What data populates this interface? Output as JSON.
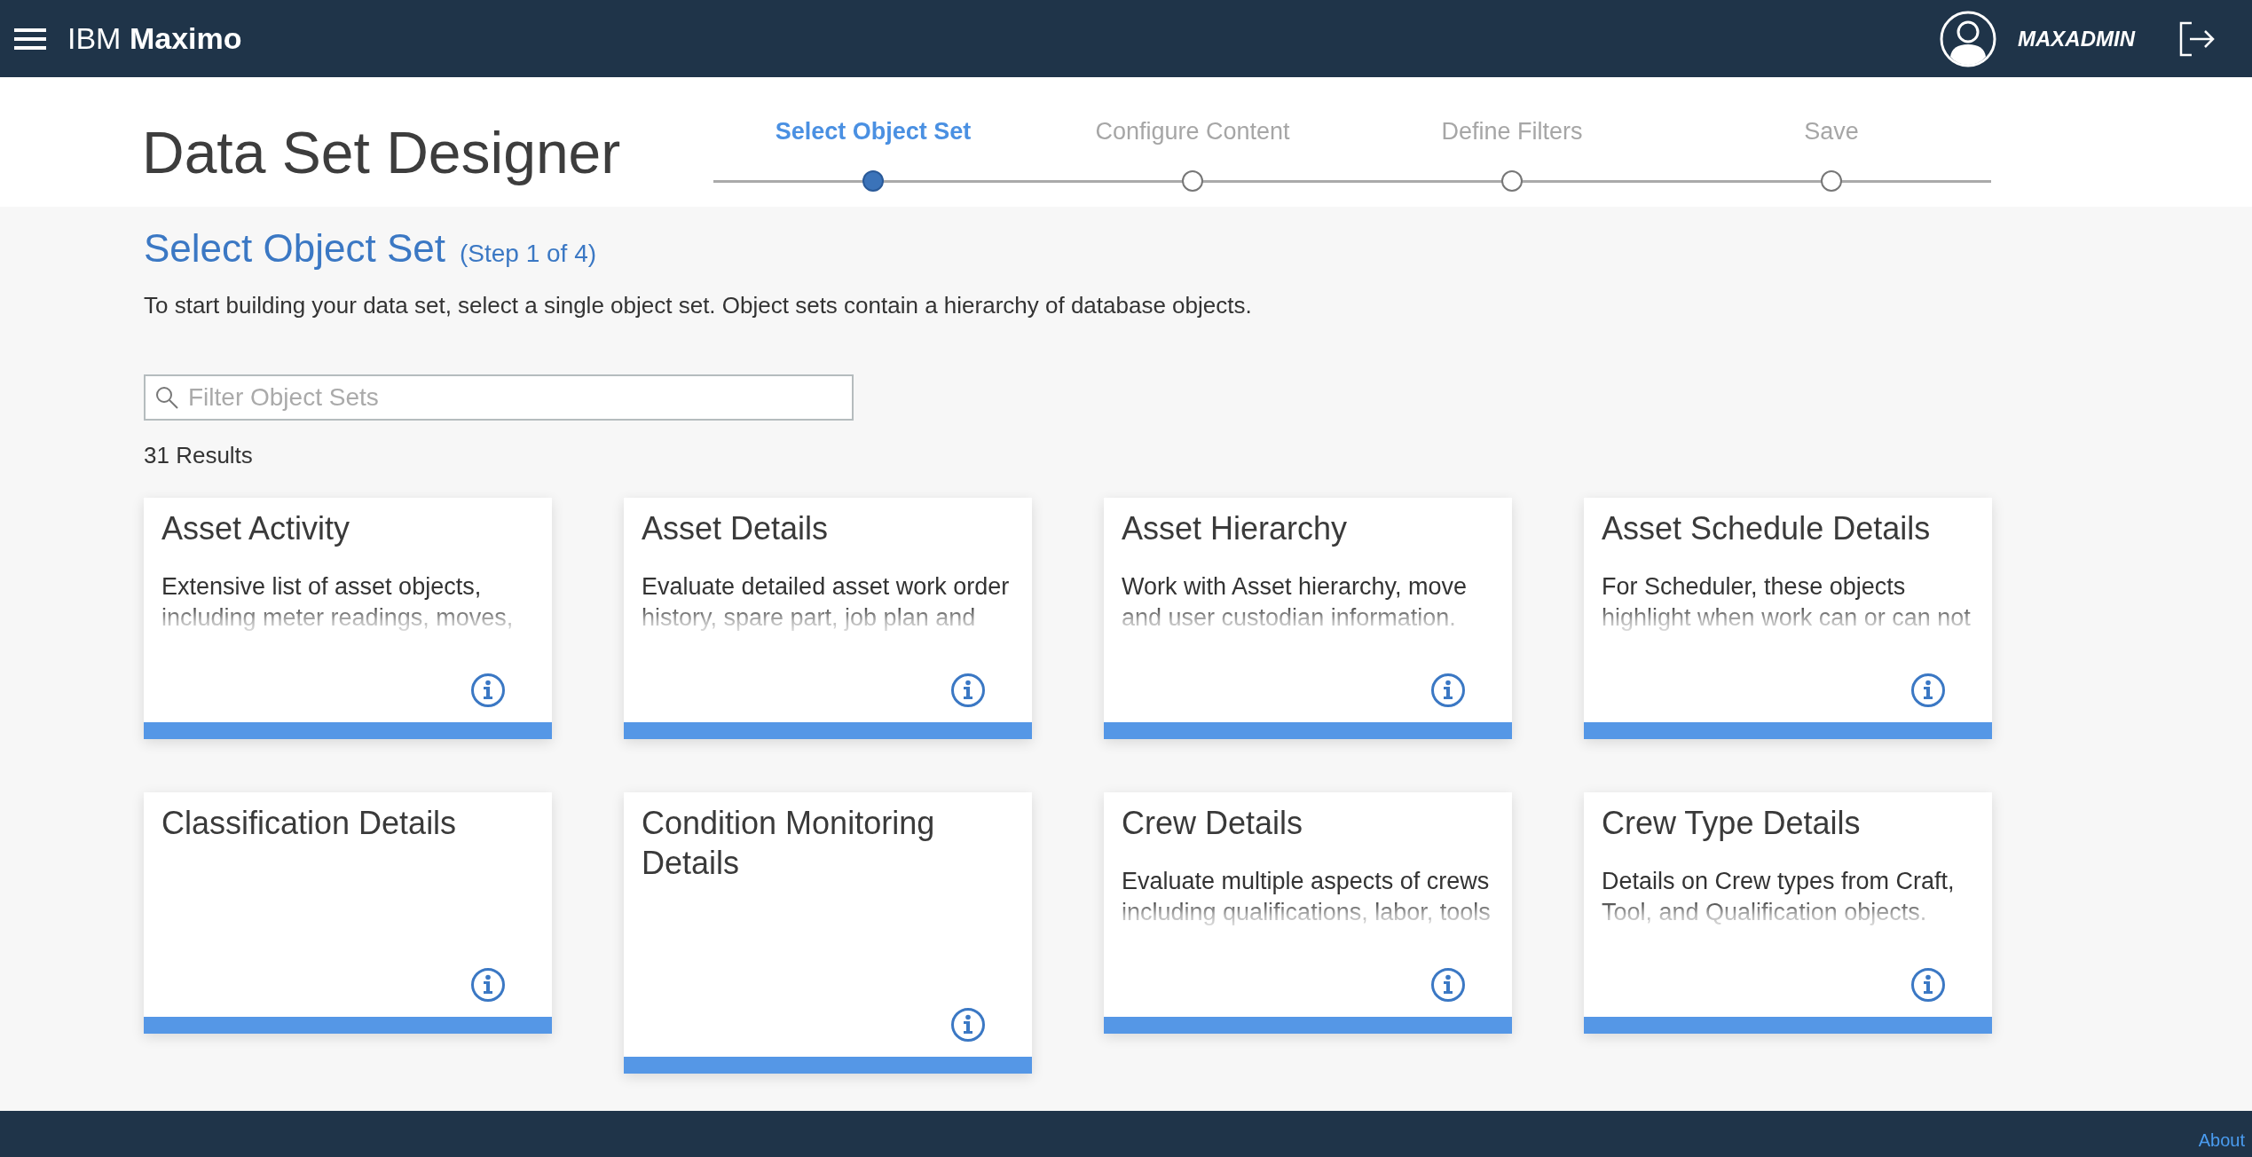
{
  "header": {
    "brand_prefix": "IBM",
    "brand_name": "Maximo",
    "user": "MAXADMIN"
  },
  "page_title": "Data Set Designer",
  "steps": [
    {
      "label": "Select Object Set",
      "selected": true
    },
    {
      "label": "Configure Content",
      "selected": false
    },
    {
      "label": "Define Filters",
      "selected": false
    },
    {
      "label": "Save",
      "selected": false
    }
  ],
  "section": {
    "title": "Select Object Set",
    "step": "(Step 1 of 4)",
    "description": "To start building your data set, select a single object set. Object sets contain a hierarchy of database objects."
  },
  "search": {
    "placeholder": "Filter Object Sets"
  },
  "results_count": "31 Results",
  "cards": [
    {
      "title": "Asset Activity",
      "description": "Extensive list of asset objects, including meter readings, moves,"
    },
    {
      "title": "Asset Details",
      "description": "Evaluate detailed asset work order history, spare part, job plan and"
    },
    {
      "title": "Asset Hierarchy",
      "description": "Work with Asset hierarchy, move and user custodian information."
    },
    {
      "title": "Asset Schedule Details",
      "description": "For Scheduler, these objects highlight when work can or can not"
    },
    {
      "title": "Classification Details"
    },
    {
      "title": "Condition Monitoring Details"
    },
    {
      "title": "Crew Details",
      "description": "Evaluate multiple aspects of crews including qualifications, labor, tools"
    },
    {
      "title": "Crew Type Details",
      "description": "Details on Crew types from Craft, Tool, and Qualification objects."
    }
  ],
  "footer": {
    "link": "About"
  }
}
